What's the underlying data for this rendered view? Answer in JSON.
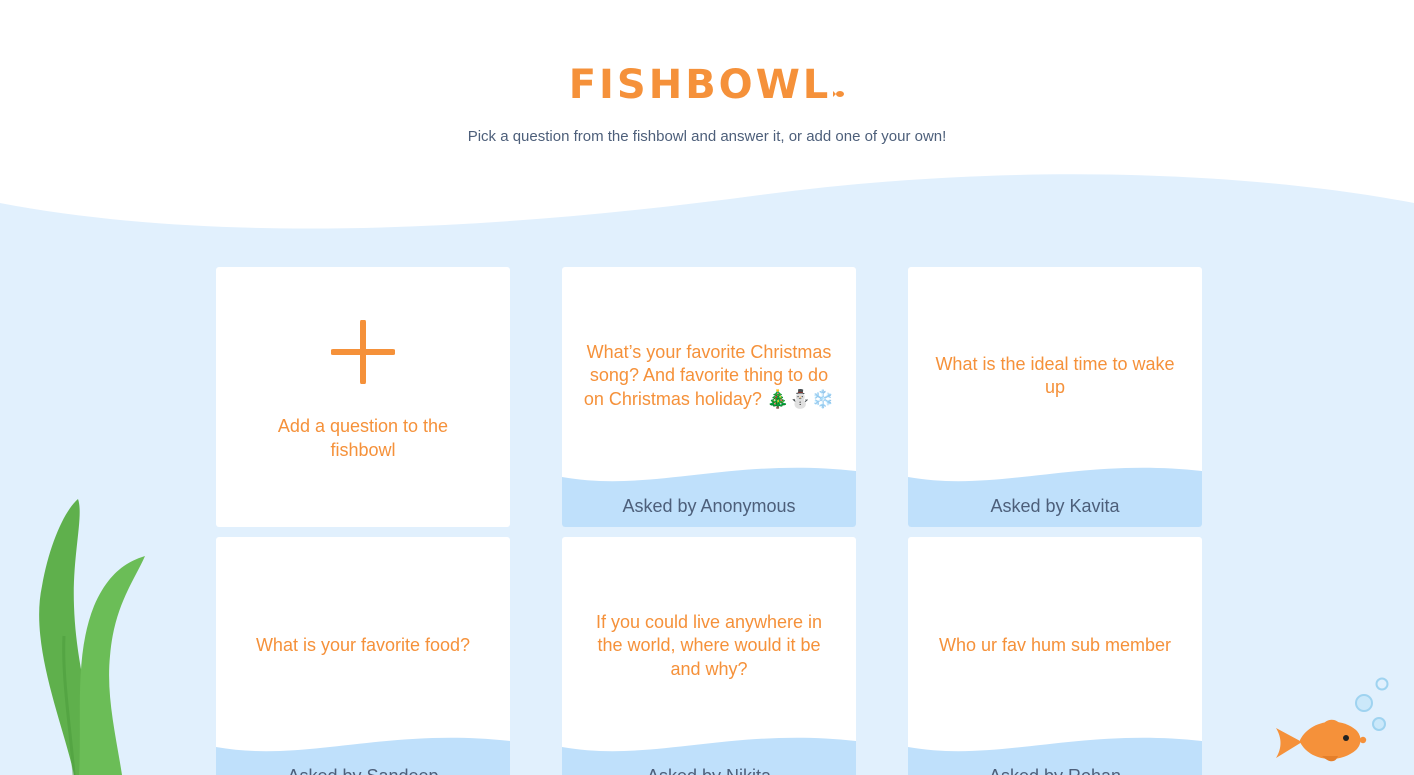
{
  "header": {
    "logo_text": "FISHBOWL",
    "subtitle": "Pick a question from the fishbowl and answer it, or add one of your own!"
  },
  "add_card": {
    "label": "Add a question to the fishbowl"
  },
  "cards": [
    {
      "question": "What’s your favorite Christmas song? And favorite thing to do on Christmas holiday? 🎄⛄❄️",
      "asked_by": "Asked by Anonymous"
    },
    {
      "question": "What is the ideal time to wake up",
      "asked_by": "Asked by Kavita"
    },
    {
      "question": "What is your favorite food?",
      "asked_by": "Asked by Sandeep"
    },
    {
      "question": "If you could live anywhere in the world, where would it be and why?",
      "asked_by": "Asked by Nikita"
    },
    {
      "question": "Who ur fav hum sub member",
      "asked_by": "Asked by Rohan"
    }
  ],
  "colors": {
    "accent": "#f5913a",
    "water": "#e1f0fd",
    "card_wave": "#bfe0fb",
    "text_muted": "#4d5f7a",
    "seaweed": "#5fb04c"
  },
  "icons": {
    "add": "plus-icon",
    "logo_mark": "fish-icon",
    "decor_left": "seaweed-icon",
    "decor_right": "goldfish-icon"
  }
}
